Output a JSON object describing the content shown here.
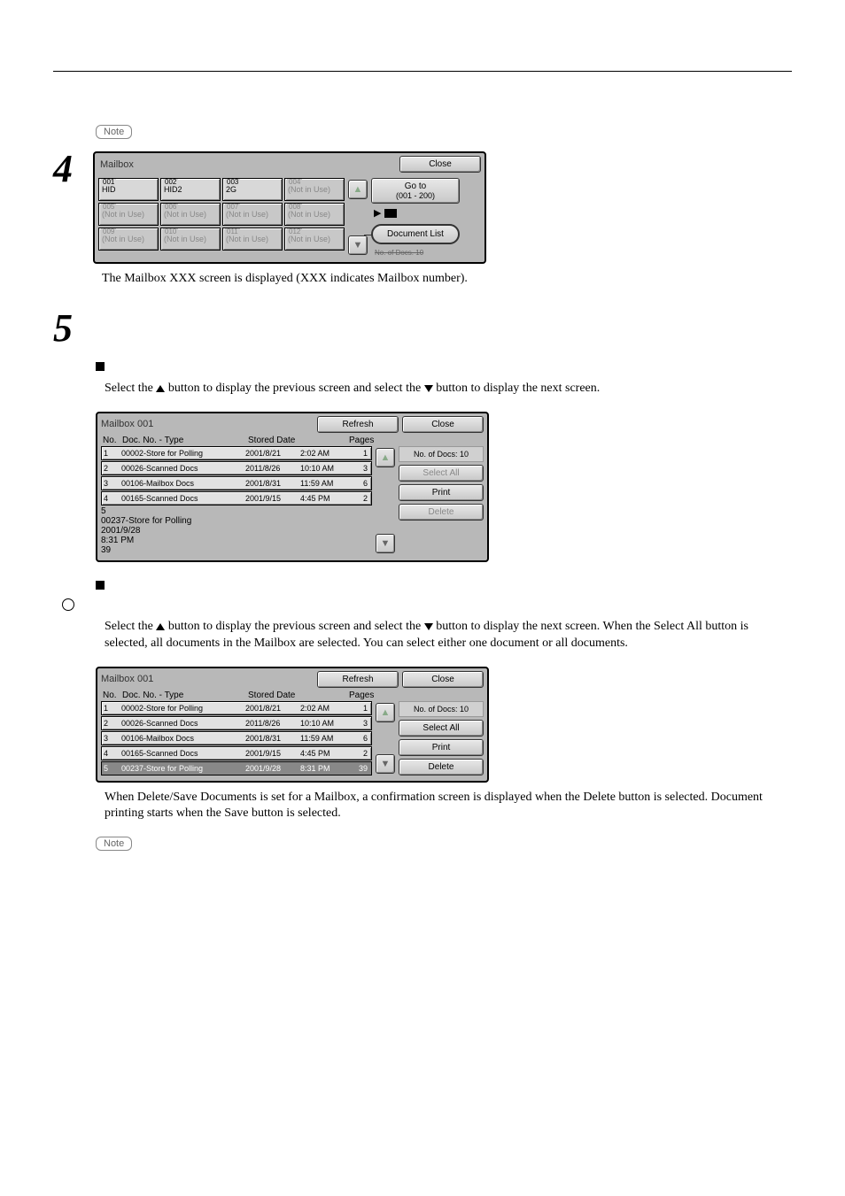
{
  "note_label": "Note",
  "caption_mailbox": "The Mailbox XXX screen is displayed (XXX indicates Mailbox number).",
  "step4_num": "4",
  "step5_num": "5",
  "panel_mailbox": {
    "title": "Mailbox",
    "close": "Close",
    "goto": "Go to",
    "goto_range": "(001 - 200)",
    "doclist": "Document List",
    "nodocs_strike": "No. of Docs.  10",
    "cells": [
      {
        "num": "001",
        "label": "HID",
        "active": true
      },
      {
        "num": "002",
        "label": "HID2",
        "active": true
      },
      {
        "num": "003",
        "label": "2G",
        "active": true
      },
      {
        "num": "004",
        "label": "(Not in Use)",
        "active": false
      },
      {
        "num": "005",
        "label": "(Not in Use)",
        "active": false
      },
      {
        "num": "006",
        "label": "(Not in Use)",
        "active": false
      },
      {
        "num": "007",
        "label": "(Not in Use)",
        "active": false
      },
      {
        "num": "008",
        "label": "(Not in Use)",
        "active": false
      },
      {
        "num": "009",
        "label": "(Not in Use)",
        "active": false
      },
      {
        "num": "010",
        "label": "(Not in Use)",
        "active": false
      },
      {
        "num": "011",
        "label": "(Not in Use)",
        "active": false
      },
      {
        "num": "012",
        "label": "(Not in Use)",
        "active": false
      }
    ]
  },
  "select_sentence_a": "Select the ",
  "select_sentence_b": " button to display the previous screen and select the ",
  "select_sentence_c": " button to display the next screen.",
  "select_all_sentence": "When the Select All button is selected, all documents in the Mailbox are selected. You can select either one document or all documents.",
  "delete_save_sentence": "When Delete/Save Documents is set for a Mailbox, a confirmation screen is displayed when the Delete button is selected. Document printing starts when the Save button is selected.",
  "list_panel": {
    "title": "Mailbox 001",
    "refresh": "Refresh",
    "close": "Close",
    "cols": {
      "no": "No.",
      "doc": "Doc. No. - Type",
      "date": "Stored Date",
      "pages": "Pages"
    },
    "count": "No. of Docs: 10",
    "select_all": "Select All",
    "print": "Print",
    "delete": "Delete",
    "rows": [
      {
        "n": "1",
        "name": "00002-Store for Polling",
        "d": "2001/8/21",
        "t": "2:02 AM",
        "p": "1"
      },
      {
        "n": "2",
        "name": "00026-Scanned Docs",
        "d": "2011/8/26",
        "t": "10:10 AM",
        "p": "3"
      },
      {
        "n": "3",
        "name": "00106-Mailbox Docs",
        "d": "2001/8/31",
        "t": "11:59 AM",
        "p": "6"
      },
      {
        "n": "4",
        "name": "00165-Scanned Docs",
        "d": "2001/9/15",
        "t": "4:45 PM",
        "p": "2"
      },
      {
        "n": "5",
        "name": "00237-Store for Polling",
        "d": "2001/9/28",
        "t": "8:31 PM",
        "p": "39"
      }
    ]
  }
}
